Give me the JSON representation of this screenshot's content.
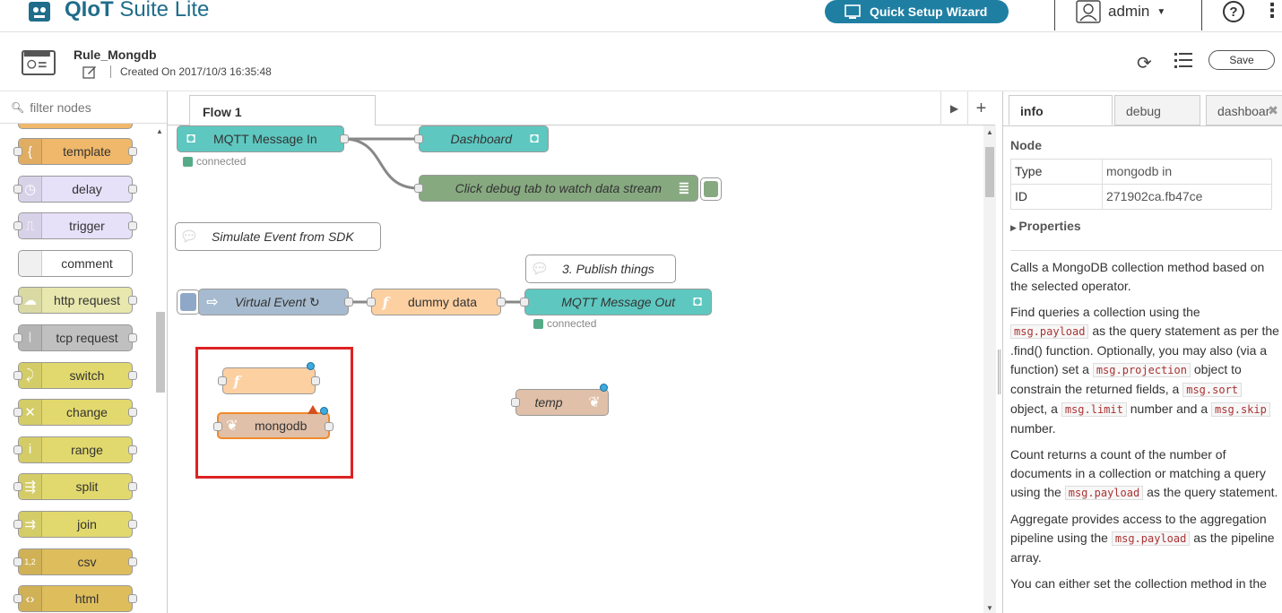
{
  "app": {
    "title_bold": "QIoT",
    "title_rest": " Suite Lite",
    "wizard_label": "Quick Setup Wizard",
    "user": "admin",
    "help_glyph": "?",
    "accent": "#1f7fa3"
  },
  "rule": {
    "name": "Rule_Mongdb",
    "created": "Created On 2017/10/3 16:35:48",
    "save_label": "Save"
  },
  "palette": {
    "filter_placeholder": "filter nodes",
    "nodes": [
      {
        "label": "template",
        "color": "#f0b86a",
        "icon": "{"
      },
      {
        "label": "delay",
        "color": "#e6e0f8",
        "icon": "◷"
      },
      {
        "label": "trigger",
        "color": "#e6e0f8",
        "icon": "⎍"
      },
      {
        "label": "comment",
        "color": "#ffffff",
        "icon": ""
      },
      {
        "label": "http request",
        "color": "#e7e7ae",
        "icon": "☁"
      },
      {
        "label": "tcp request",
        "color": "#c0c0c0",
        "icon": "⦚"
      },
      {
        "label": "switch",
        "color": "#e2d96e",
        "icon": "⤸"
      },
      {
        "label": "change",
        "color": "#e2d96e",
        "icon": "✕"
      },
      {
        "label": "range",
        "color": "#e2d96e",
        "icon": "i"
      },
      {
        "label": "split",
        "color": "#e2d96e",
        "icon": "⇶"
      },
      {
        "label": "join",
        "color": "#e2d96e",
        "icon": "⇉"
      },
      {
        "label": "csv",
        "color": "#debd5c",
        "icon": "1,2"
      },
      {
        "label": "html",
        "color": "#debd5c",
        "icon": "‹›"
      }
    ]
  },
  "workspace": {
    "tab": "Flow 1",
    "nodes": {
      "mqtt_in": "MQTT Message In",
      "mqtt_in_status": "connected",
      "dashboard": "Dashboard",
      "debug": "Click debug tab to watch data stream",
      "comment1": "Simulate Event from SDK",
      "comment2": "3. Publish things",
      "virtual_event": "Virtual Event ↻",
      "dummy": "dummy data",
      "mqtt_out": "MQTT Message Out",
      "mqtt_out_status": "connected",
      "mongodb": "mongodb",
      "temp": "temp"
    }
  },
  "sidebar": {
    "tabs": [
      "info",
      "debug",
      "dashboar"
    ],
    "node_heading": "Node",
    "type_key": "Type",
    "type_val": "mongodb in",
    "id_key": "ID",
    "id_val": "271902ca.fb47ce",
    "properties": "Properties",
    "p1": "Calls a MongoDB collection method based on the selected operator.",
    "p2a": "Find queries a collection using the",
    "p2b": "as the query statement as per the .find() function. Optionally, you may also (via a function) set a",
    "p2c": "object to constrain the returned fields, a",
    "p2d": "object, a",
    "p2e": "number and a",
    "p2f": "number.",
    "p3a": "Count returns a count of the number of documents in a collection or matching a query using the",
    "p3b": "as the query statement.",
    "p4a": "Aggregate provides access to the aggregation pipeline using the",
    "p4b": "as the pipeline array.",
    "p5": "You can either set the collection method in the",
    "code_payload": "msg.payload",
    "code_projection": "msg.projection",
    "code_sort": "msg.sort",
    "code_limit": "msg.limit",
    "code_skip": "msg.skip"
  }
}
